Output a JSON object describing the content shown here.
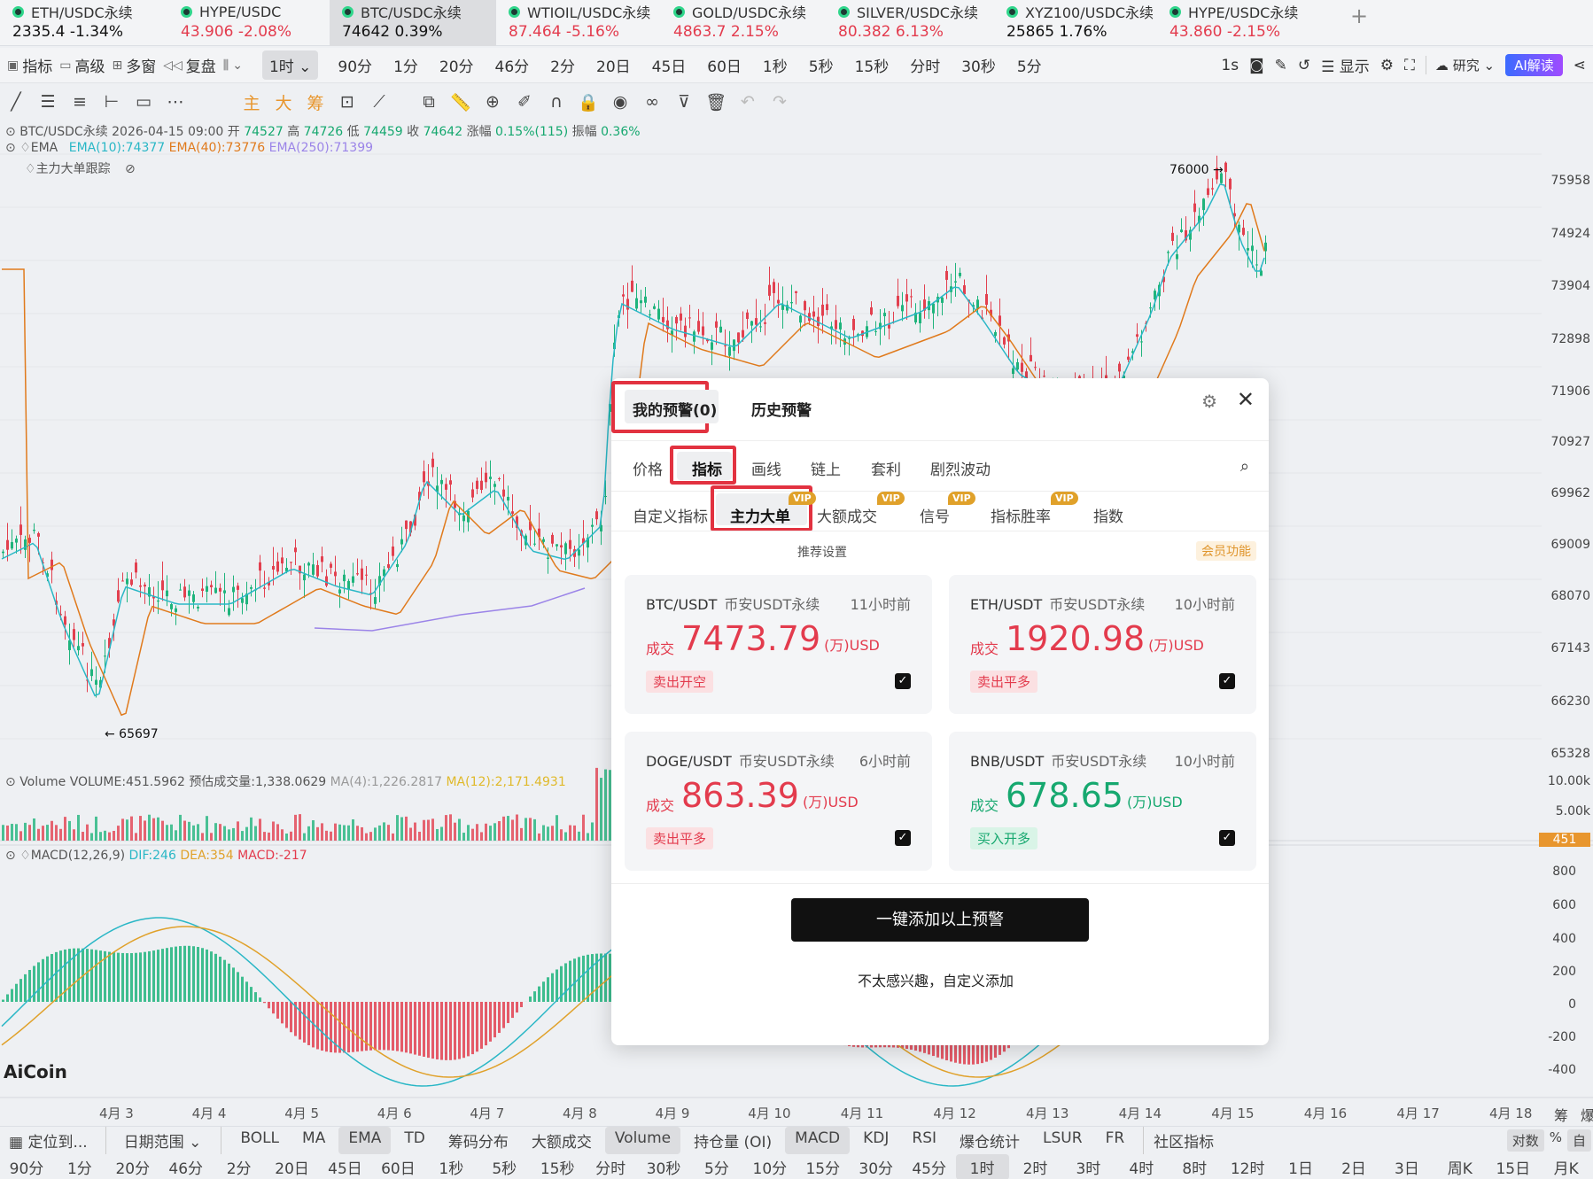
{
  "tickers": [
    {
      "name": "ETH/USDC永续",
      "value": "2335.4 -1.34%",
      "dir": "black"
    },
    {
      "name": "HYPE/USDC",
      "value": "43.906 -2.08%",
      "dir": "down"
    },
    {
      "name": "BTC/USDC永续",
      "value": "74642 0.39%",
      "dir": "black"
    },
    {
      "name": "WTIOIL/USDC永续",
      "value": "87.464 -5.16%",
      "dir": "down"
    },
    {
      "name": "GOLD/USDC永续",
      "value": "4863.7 2.15%",
      "dir": "down"
    },
    {
      "name": "SILVER/USDC永续",
      "value": "80.382 6.13%",
      "dir": "down"
    },
    {
      "name": "XYZ100/USDC永续",
      "value": "25865 1.76%",
      "dir": "black"
    },
    {
      "name": "HYPE/USDC永续",
      "value": "43.860 -2.15%",
      "dir": "down"
    }
  ],
  "plus": "+",
  "toolbar1": {
    "indicators": "指标",
    "advanced": "高级",
    "multi_window": "多窗",
    "replay": "复盘",
    "interval_selected": "1时",
    "intervals": [
      "90分",
      "1分",
      "20分",
      "46分",
      "2分",
      "20日",
      "45日",
      "60日",
      "1秒",
      "5秒",
      "15秒",
      "分时",
      "30秒",
      "5分"
    ],
    "right_interval": "1s",
    "display": "显示",
    "research": "研究",
    "ai_read": "AI解读"
  },
  "toolbar2": {
    "main": "主",
    "big": "大",
    "chip": "筹"
  },
  "chart_info": {
    "symbol_line": "BTC/USDC永续 2026-04-15 09:00",
    "open_lbl": "开",
    "open": "74527",
    "high_lbl": "高",
    "high": "74726",
    "low_lbl": "低",
    "low": "74459",
    "close_lbl": "收",
    "close": "74642",
    "change_lbl": "涨幅",
    "change": "0.15%(115)",
    "amp_lbl": "振幅",
    "amp": "0.36%",
    "ema_label": "EMA",
    "ema10": "EMA(10):74377",
    "ema40": "EMA(40):73776",
    "ema250": "EMA(250):71399",
    "big_order_track": "主力大单跟踪",
    "high_mark": "76000 →",
    "low_mark": "← 65697",
    "volume_line": "Volume VOLUME:451.5962",
    "volume_est": "预估成交量:1,338.0629",
    "ma4": "MA(4):1,226.2817",
    "ma12": "MA(12):2,171.4931",
    "macd_label": "MACD(12,26,9)",
    "dif": "DIF:246",
    "dea": "DEA:354",
    "macd": "MACD:-217",
    "logo": "AiCoin"
  },
  "price_axis": [
    "75958",
    "74924",
    "73904",
    "72898",
    "71906",
    "70927",
    "69962",
    "69009",
    "68070",
    "67143",
    "66230",
    "65328"
  ],
  "volume_axis": [
    "10.00k",
    "5.00k",
    "451"
  ],
  "macd_axis": [
    "800",
    "600",
    "400",
    "200",
    "0",
    "-200",
    "-400"
  ],
  "date_axis": [
    "4月 3",
    "4月 4",
    "4月 5",
    "4月 6",
    "4月 7",
    "4月 8",
    "4月 9",
    "4月 10",
    "4月 11",
    "4月 12",
    "4月 13",
    "4月 14",
    "4月 15",
    "4月 16",
    "4月 17",
    "4月 18"
  ],
  "axis_chip": "筹",
  "axis_trunc": "爆",
  "modal": {
    "tab_my": "我的预警(0)",
    "tab_history": "历史预警",
    "categories": [
      "价格",
      "指标",
      "画线",
      "链上",
      "套利",
      "剧烈波动"
    ],
    "subtabs": [
      "自定义指标",
      "主力大单",
      "大额成交",
      "信号",
      "指标胜率",
      "指数"
    ],
    "vip": "VIP",
    "recommend": "推荐设置",
    "member": "会员功能",
    "cards": [
      {
        "pair": "BTC/USDT",
        "exchange": "币安USDT永续",
        "time": "11小时前",
        "label": "成交",
        "value": "7473.79",
        "unit": "(万)USD",
        "action": "卖出开空",
        "color": "red"
      },
      {
        "pair": "ETH/USDT",
        "exchange": "币安USDT永续",
        "time": "10小时前",
        "label": "成交",
        "value": "1920.98",
        "unit": "(万)USD",
        "action": "卖出平多",
        "color": "red"
      },
      {
        "pair": "DOGE/USDT",
        "exchange": "币安USDT永续",
        "time": "6小时前",
        "label": "成交",
        "value": "863.39",
        "unit": "(万)USD",
        "action": "卖出平多",
        "color": "red"
      },
      {
        "pair": "BNB/USDT",
        "exchange": "币安USDT永续",
        "time": "10小时前",
        "label": "成交",
        "value": "678.65",
        "unit": "(万)USD",
        "action": "买入开多",
        "color": "green"
      }
    ],
    "add_button": "一键添加以上预警",
    "custom_link": "不太感兴趣，自定义添加"
  },
  "bottom1": {
    "locate": "定位到...",
    "date_range": "日期范围",
    "items": [
      "BOLL",
      "MA",
      "EMA",
      "TD",
      "筹码分布",
      "大额成交",
      "Volume",
      "持仓量 (OI)",
      "MACD",
      "KDJ",
      "RSI",
      "爆仓统计",
      "LSUR",
      "FR",
      "社区指标"
    ],
    "log": "对数",
    "pct": "%",
    "auto": "自"
  },
  "bottom2": [
    "90分",
    "1分",
    "20分",
    "46分",
    "2分",
    "20日",
    "45日",
    "60日",
    "1秒",
    "5秒",
    "15秒",
    "分时",
    "30秒",
    "5分",
    "10分",
    "15分",
    "30分",
    "45分",
    "1时",
    "2时",
    "3时",
    "4时",
    "8时",
    "12时",
    "1日",
    "2日",
    "3日",
    "周K",
    "15日",
    "月K"
  ]
}
